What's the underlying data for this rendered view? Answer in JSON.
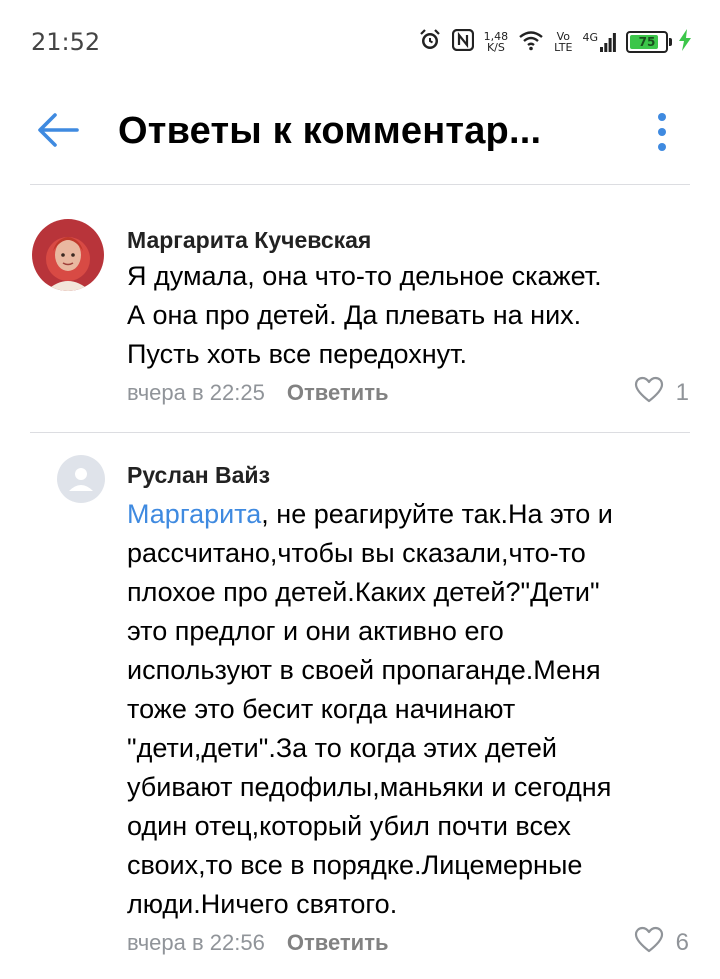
{
  "status_bar": {
    "time": "21:52",
    "net_speed_value": "1,48",
    "net_speed_unit": "K/S",
    "volte_top": "Vo",
    "volte_bottom": "LTE",
    "network": "4G",
    "battery": "75"
  },
  "header": {
    "title": "Ответы к комментар..."
  },
  "comments": [
    {
      "author": "Маргарита Кучевская",
      "lines": [
        "Я думала, она что-то дельное скажет.",
        "А она про детей. Да плевать на них.",
        "Пусть хоть все передохнут."
      ],
      "time": "вчера в 22:25",
      "reply_label": "Ответить",
      "likes": "1"
    },
    {
      "author": "Руслан Вайз",
      "mention": "Маргарита",
      "first_line_rest": ", не реагируйте так.На это и",
      "lines": [
        "рассчитано,чтобы вы сказали,что-то",
        "плохое про детей.Каких детей?\"Дети\"",
        "это предлог и они активно его",
        "используют в своей пропаганде.Меня",
        "тоже это бесит когда начинают",
        "\"дети,дети\".За то когда этих детей",
        "убивают педофилы,маньяки и сегодня",
        "один отец,который убил почти всех",
        "своих,то все в порядке.Лицемерные",
        "люди.Ничего святого."
      ],
      "time": "вчера в 22:56",
      "reply_label": "Ответить",
      "likes": "6"
    }
  ],
  "colors": {
    "accent": "#3f8ae0",
    "meta": "#909499",
    "battery": "#3cc64a"
  }
}
